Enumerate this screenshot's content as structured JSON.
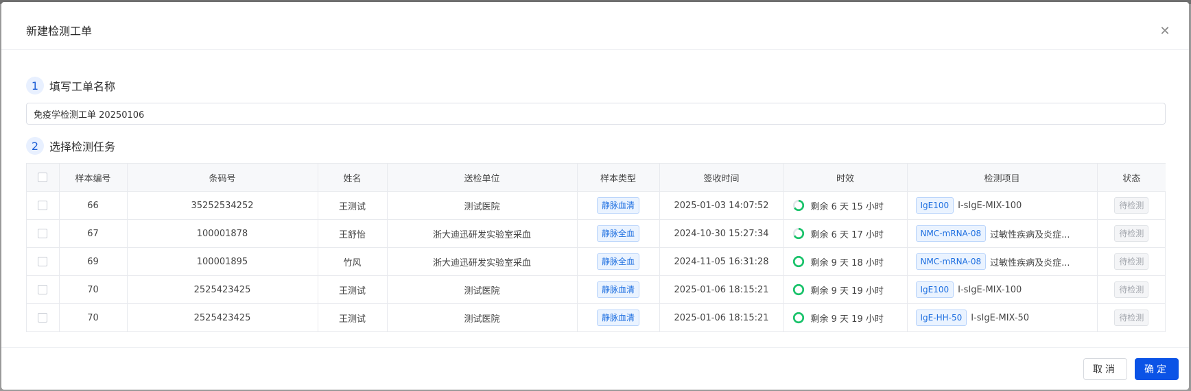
{
  "modal": {
    "title": "新建检测工单",
    "close_icon": "close-icon"
  },
  "step1": {
    "num": "1",
    "label": "填写工单名称"
  },
  "step2": {
    "num": "2",
    "label": "选择检测任务"
  },
  "name_input": {
    "value": "免疫学检测工单 20250106"
  },
  "table": {
    "headers": [
      "样本编号",
      "条码号",
      "姓名",
      "送检单位",
      "样本类型",
      "签收时间",
      "时效",
      "检测项目",
      "状态"
    ],
    "rows": [
      {
        "sample_no": "66",
        "barcode": "35252534252",
        "name": "王测试",
        "unit": "测试医院",
        "sample_type": "静脉血清",
        "received": "2025-01-03 14:07:52",
        "time_left": "剩余 6 天 15 小时",
        "remaining_fraction": 0.66,
        "item_code": "IgE100",
        "item_name": "I-sIgE-MIX-100",
        "status": "待检测"
      },
      {
        "sample_no": "67",
        "barcode": "100001878",
        "name": "王舒怡",
        "unit": "浙大迪迅研发实验室采血",
        "sample_type": "静脉全血",
        "received": "2024-10-30 15:27:34",
        "time_left": "剩余 6 天 17 小时",
        "remaining_fraction": 0.67,
        "item_code": "NMC-mRNA-08",
        "item_name": "过敏性疾病及炎症...",
        "status": "待检测"
      },
      {
        "sample_no": "69",
        "barcode": "100001895",
        "name": "竹风",
        "unit": "浙大迪迅研发实验室采血",
        "sample_type": "静脉全血",
        "received": "2024-11-05 16:31:28",
        "time_left": "剩余 9 天 18 小时",
        "remaining_fraction": 1.0,
        "item_code": "NMC-mRNA-08",
        "item_name": "过敏性疾病及炎症...",
        "status": "待检测"
      },
      {
        "sample_no": "70",
        "barcode": "2525423425",
        "name": "王测试",
        "unit": "测试医院",
        "sample_type": "静脉血清",
        "received": "2025-01-06 18:15:21",
        "time_left": "剩余 9 天 19 小时",
        "remaining_fraction": 1.0,
        "item_code": "IgE100",
        "item_name": "I-sIgE-MIX-100",
        "status": "待检测"
      },
      {
        "sample_no": "70",
        "barcode": "2525423425",
        "name": "王测试",
        "unit": "测试医院",
        "sample_type": "静脉血清",
        "received": "2025-01-06 18:15:21",
        "time_left": "剩余 9 天 19 小时",
        "remaining_fraction": 1.0,
        "item_code": "IgE-HH-50",
        "item_name": "I-sIgE-MIX-50",
        "status": "待检测"
      }
    ]
  },
  "footer": {
    "cancel_label": "取消",
    "ok_label": "确定"
  },
  "colors": {
    "accent": "#0b53e6",
    "ring_green": "#19c36a",
    "ring_track": "#e3e6ea"
  }
}
